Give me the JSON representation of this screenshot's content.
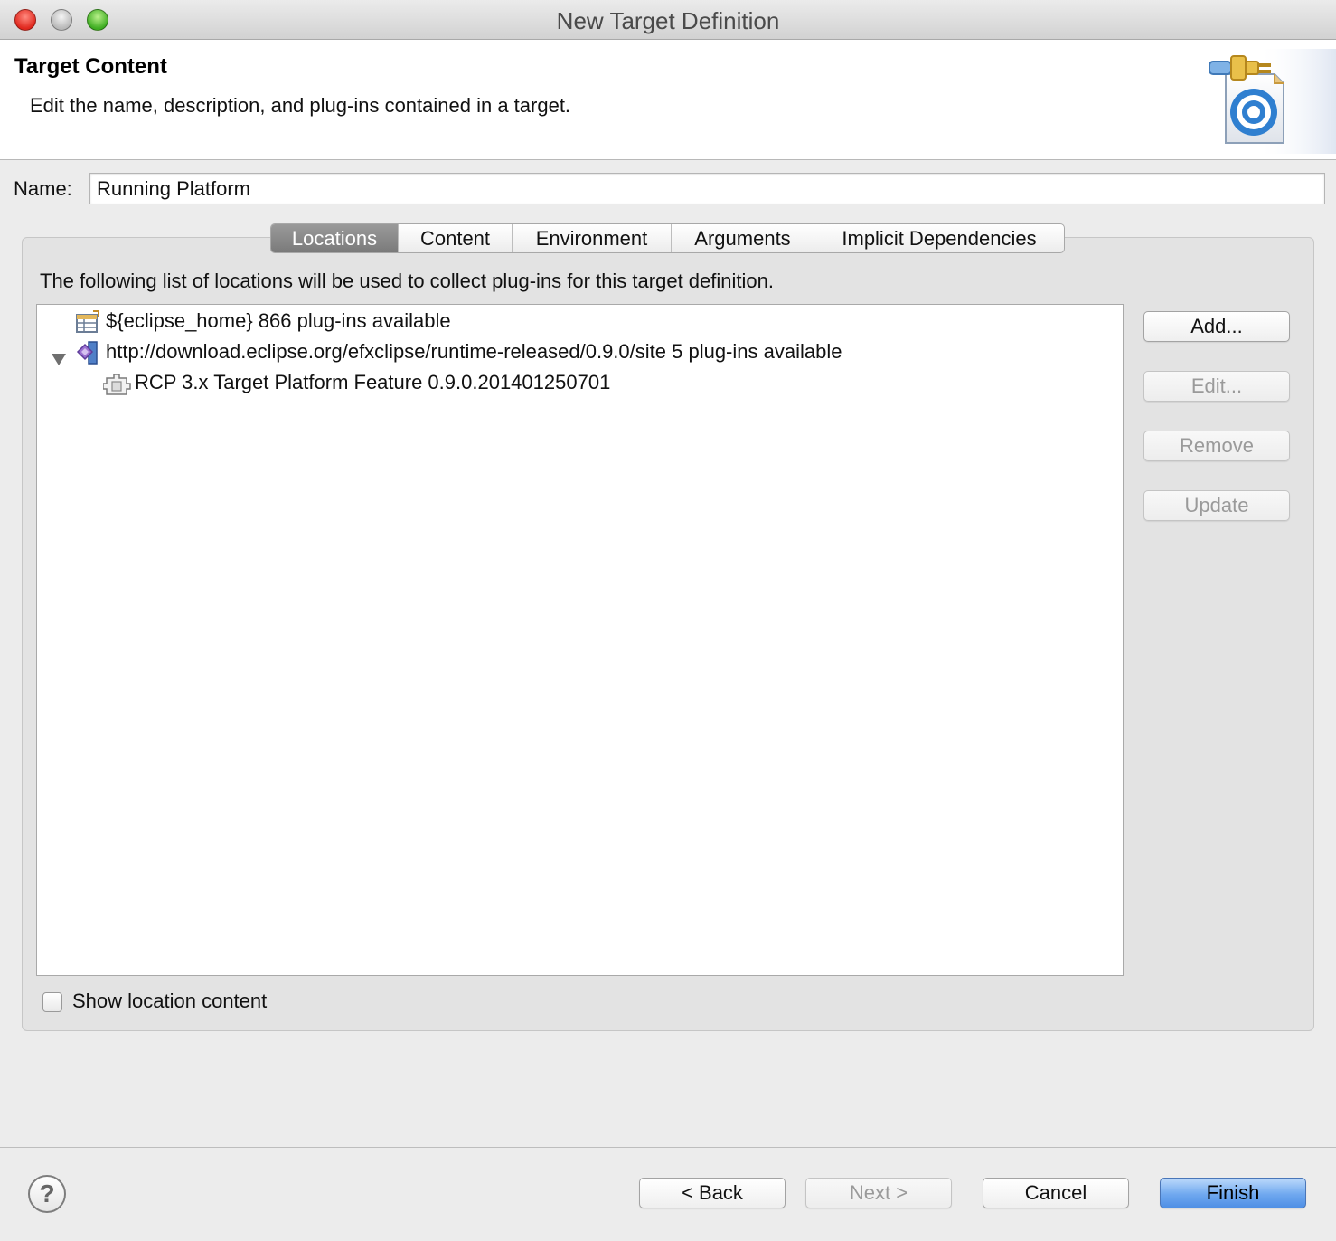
{
  "window": {
    "title": "New Target Definition"
  },
  "header": {
    "title": "Target Content",
    "description": "Edit the name, description, and plug-ins contained in a target.",
    "graphic_icon": "target-wizard-icon"
  },
  "name_field": {
    "label": "Name:",
    "value": "Running Platform"
  },
  "tabs": [
    {
      "label": "Locations",
      "selected": true
    },
    {
      "label": "Content",
      "selected": false
    },
    {
      "label": "Environment",
      "selected": false
    },
    {
      "label": "Arguments",
      "selected": false
    },
    {
      "label": "Implicit Dependencies",
      "selected": false
    }
  ],
  "locations": {
    "description": "The following list of locations will be used to collect plug-ins for this target definition.",
    "tree": [
      {
        "label": "${eclipse_home} 866 plug-ins available",
        "icon": "installation-location-icon",
        "expanded": false,
        "level": 0
      },
      {
        "label": "http://download.eclipse.org/efxclipse/runtime-released/0.9.0/site 5 plug-ins available",
        "icon": "software-site-icon",
        "expanded": true,
        "level": 0
      },
      {
        "label": "RCP 3.x Target Platform Feature 0.9.0.201401250701",
        "icon": "feature-icon",
        "expanded": false,
        "level": 1
      }
    ],
    "buttons": {
      "add": "Add...",
      "edit": "Edit...",
      "remove": "Remove",
      "update": "Update"
    },
    "show_content": {
      "label": "Show location content",
      "checked": false
    }
  },
  "footer": {
    "help_icon": "help-icon",
    "back": "< Back",
    "next": "Next >",
    "cancel": "Cancel",
    "finish": "Finish"
  },
  "colors": {
    "primary_button": "#6fa8ef",
    "selected_tab": "#8a8a8a",
    "window_background": "#ececec"
  }
}
